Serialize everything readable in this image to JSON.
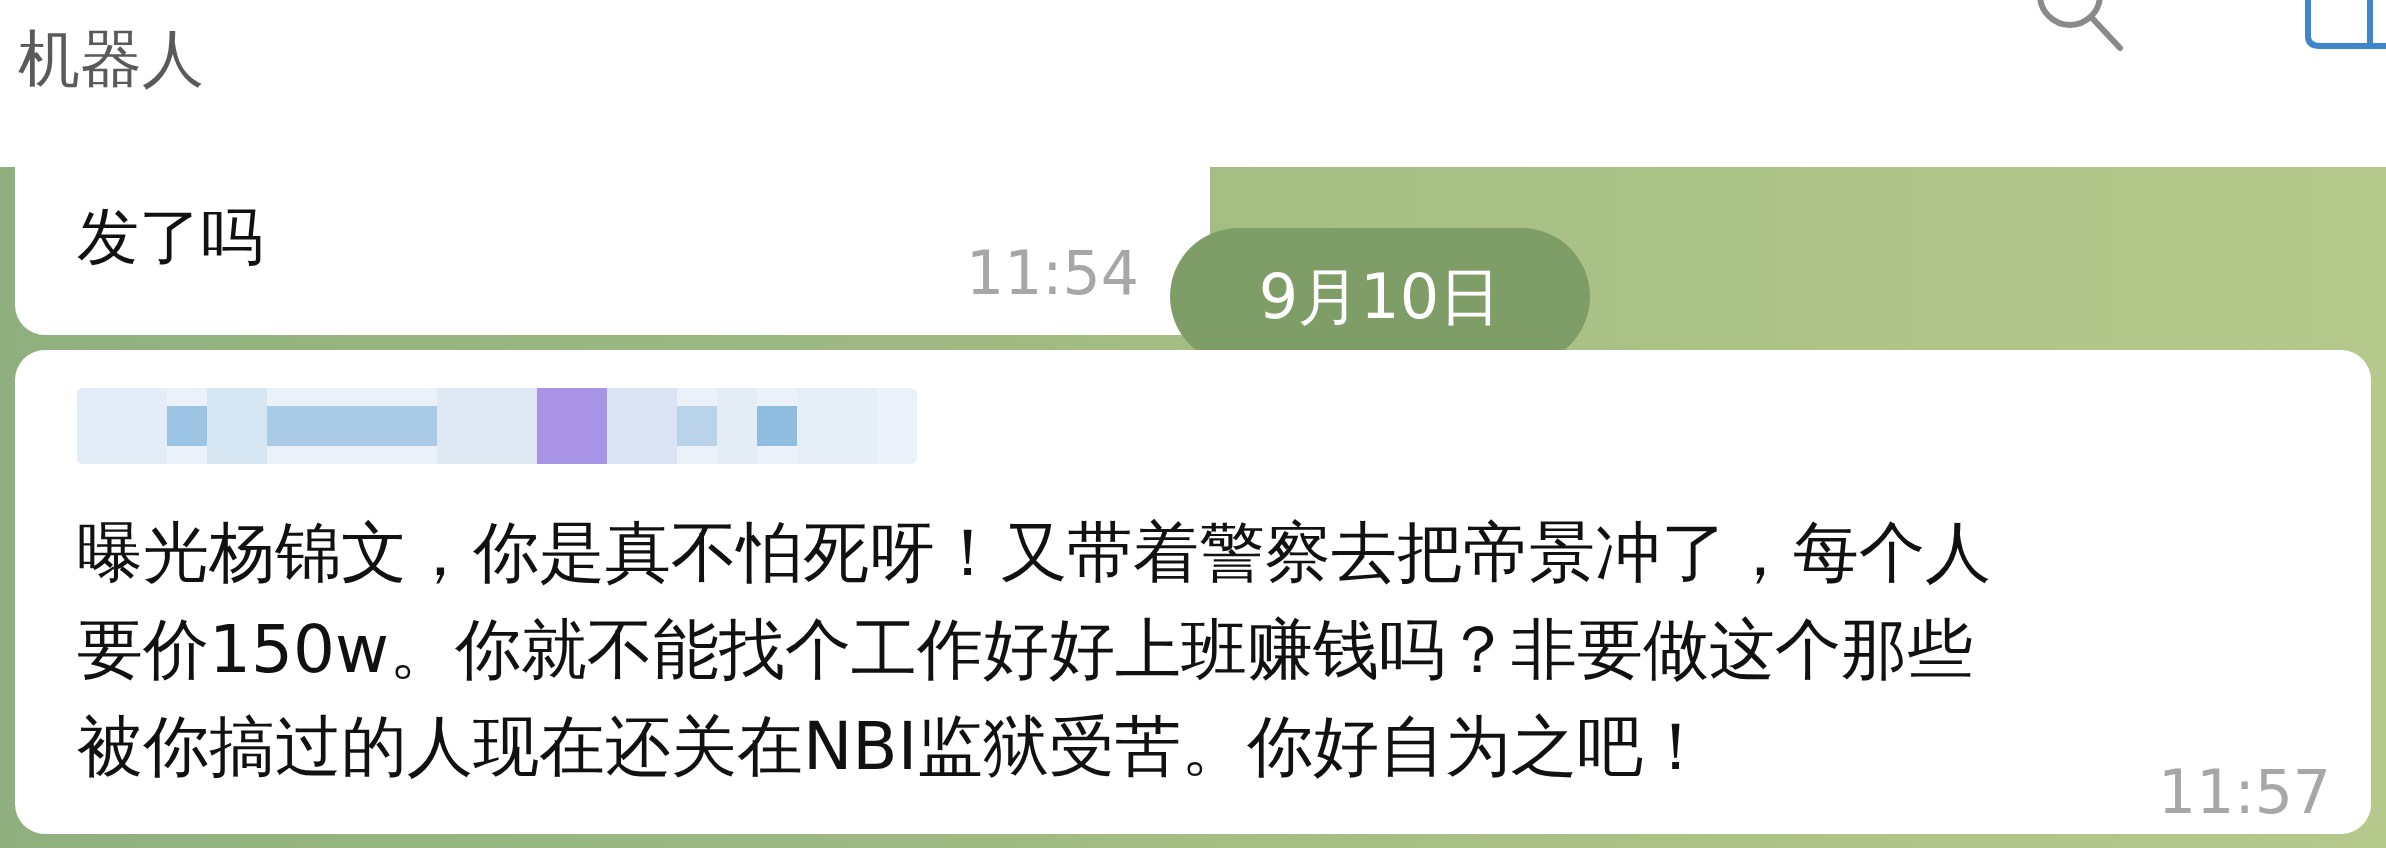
{
  "header": {
    "title": "机器人"
  },
  "items": [
    {
      "kind": "message",
      "text": "发了吗",
      "time": "11:54",
      "sender_hidden": false
    },
    {
      "kind": "date",
      "text": "9月10日"
    },
    {
      "kind": "message",
      "text": "曝光杨锦文，你是真不怕死呀！又带着警察去把帝景冲了，每个人要价150w。你就不能找个工作好好上班赚钱吗？非要做这个那些被你搞过的人现在还关在NBI监狱受苦。你好自为之吧！",
      "time": "11:57",
      "sender_hidden": true
    }
  ]
}
